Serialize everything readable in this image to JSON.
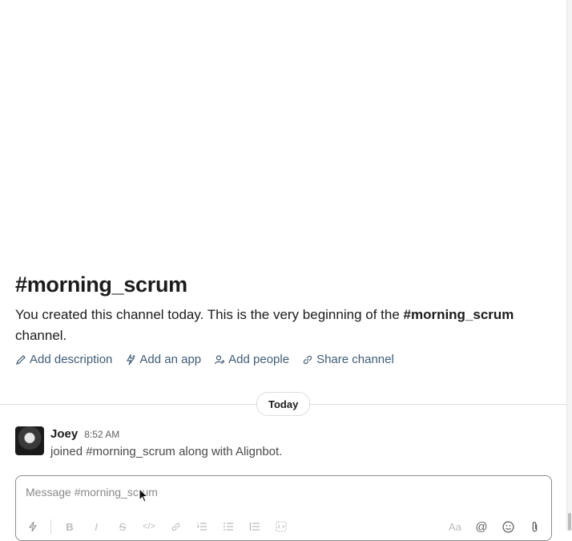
{
  "channel": {
    "title": "#morning_scrum",
    "intro_prefix": "You created this channel today. This is the very beginning of the ",
    "intro_channel": "#morning_scrum",
    "intro_suffix": " channel."
  },
  "actions": [
    {
      "label": "Add description",
      "icon": "pencil-icon"
    },
    {
      "label": "Add an app",
      "icon": "lightning-plus-icon"
    },
    {
      "label": "Add people",
      "icon": "person-plus-icon"
    },
    {
      "label": "Share channel",
      "icon": "link-icon"
    }
  ],
  "day_divider": "Today",
  "message": {
    "author": "Joey",
    "time": "8:52 AM",
    "text": "joined #morning_scrum along with Alignbot."
  },
  "composer": {
    "placeholder": "Message #morning_scrum",
    "toolbar_left": [
      "shortcuts-icon",
      "bold-icon",
      "italic-icon",
      "strikethrough-icon",
      "code-icon",
      "link-icon",
      "ordered-list-icon",
      "bulleted-list-icon",
      "blockquote-icon",
      "code-block-icon"
    ],
    "toolbar_right": [
      "formatting-icon",
      "mention-icon",
      "emoji-icon",
      "attach-icon"
    ],
    "format_label": "Aa",
    "mention_label": "@"
  },
  "colors": {
    "link": "#3e5c78",
    "text": "#1d1c1d",
    "muted": "#616061"
  }
}
